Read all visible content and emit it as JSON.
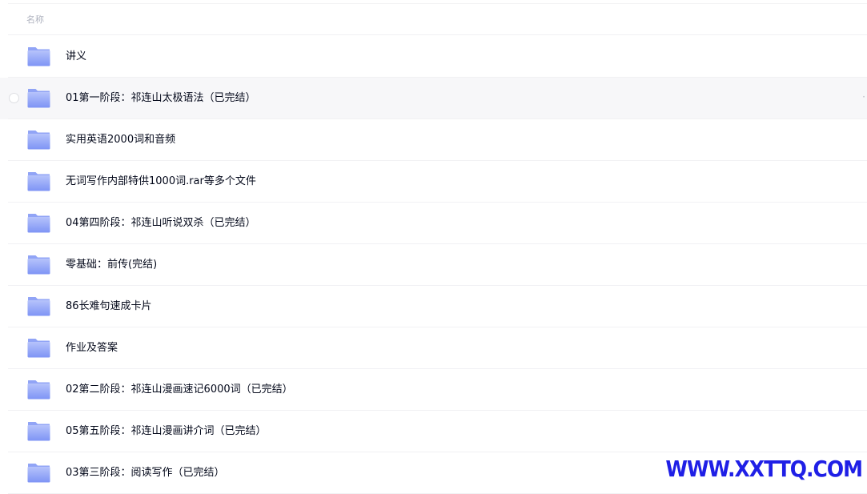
{
  "header": {
    "name_column_label": "名称"
  },
  "rows": [
    {
      "name": "讲义",
      "icon": "folder-icon"
    },
    {
      "name": "01第一阶段：祁连山太极语法（已完结）",
      "icon": "folder-icon",
      "hovered": true,
      "more_label": "·"
    },
    {
      "name": "实用英语2000词和音频",
      "icon": "folder-icon"
    },
    {
      "name": "无词写作内部特供1000词.rar等多个文件",
      "icon": "folder-icon"
    },
    {
      "name": "04第四阶段：祁连山听说双杀（已完结）",
      "icon": "folder-icon"
    },
    {
      "name": "零基础：前传(完结)",
      "icon": "folder-icon"
    },
    {
      "name": "86长难句速成卡片",
      "icon": "folder-icon"
    },
    {
      "name": "作业及答案",
      "icon": "folder-icon"
    },
    {
      "name": "02第二阶段：祁连山漫画速记6000词（已完结）",
      "icon": "folder-icon"
    },
    {
      "name": "05第五阶段：祁连山漫画讲介词（已完结）",
      "icon": "folder-icon"
    },
    {
      "name": "03第三阶段：阅读写作（已完结）",
      "icon": "folder-icon"
    }
  ],
  "watermark": {
    "text": "WWW.XXTTQ.COM"
  },
  "colors": {
    "folder_top": "#b6c3fb",
    "folder_bottom": "#7e94f5",
    "text": "#03081a",
    "header_text": "#afb3bf",
    "hover_bg": "#f7f7f9",
    "watermark": "#1f1fe6"
  }
}
